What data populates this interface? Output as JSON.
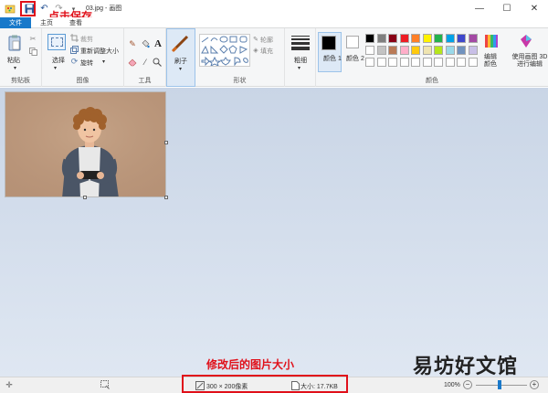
{
  "window": {
    "title": "03.jpg - 画图",
    "controls": {
      "minimize": "—",
      "maximize": "☐",
      "close": "✕"
    }
  },
  "annotations": {
    "save_hint": "点击保存",
    "size_hint": "修改后的图片大小"
  },
  "watermark": "易坊好文馆",
  "tabs": {
    "file": "文件",
    "home": "主页",
    "view": "查看"
  },
  "ribbon": {
    "clipboard": {
      "label": "剪贴板",
      "paste": "粘贴"
    },
    "image": {
      "label": "图像",
      "select": "选择",
      "crop": "裁剪",
      "resize": "重新调整大小",
      "rotate": "旋转"
    },
    "tools": {
      "label": "工具"
    },
    "brushes": {
      "label": "刷子"
    },
    "shapes": {
      "label": "形状",
      "outline": "轮廓",
      "fill": "填充"
    },
    "size": {
      "label": "粗细"
    },
    "colors": {
      "label": "颜色",
      "color1": "颜色 1",
      "color2": "颜色 2",
      "edit": "编辑颜色",
      "paint3d": "使用画图 3D 进行编辑",
      "color1_value": "#000000",
      "color2_value": "#ffffff",
      "palette_row1": [
        "#000000",
        "#7f7f7f",
        "#880015",
        "#ed1c24",
        "#ff7f27",
        "#fff200",
        "#22b14c",
        "#00a2e8",
        "#3f48cc",
        "#a349a4"
      ],
      "palette_row2": [
        "#ffffff",
        "#c3c3c3",
        "#b97a57",
        "#ffaec9",
        "#ffc90e",
        "#efe4b0",
        "#b5e61d",
        "#99d9ea",
        "#7092be",
        "#c8bfe7"
      ]
    }
  },
  "status": {
    "dimensions": "300 × 200像素",
    "file_size": "大小: 17.7KB",
    "zoom": "100%"
  }
}
